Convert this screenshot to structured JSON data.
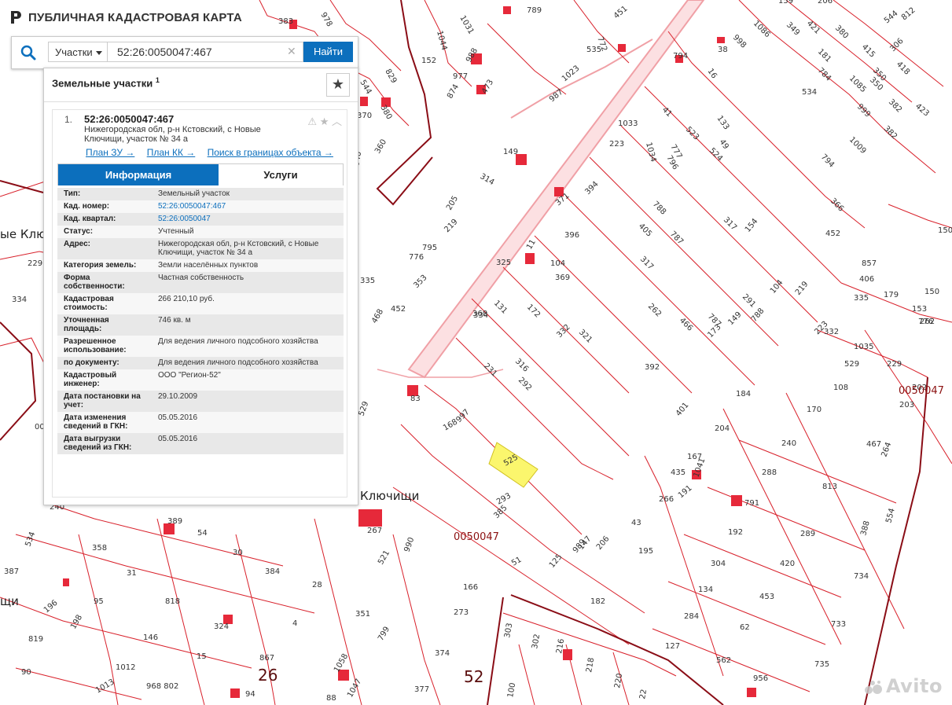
{
  "app": {
    "title": "ПУБЛИЧНАЯ КАДАСТРОВАЯ КАРТА"
  },
  "search": {
    "type": "Участки",
    "query": "52:26:0050047:467",
    "button": "Найти"
  },
  "panel": {
    "title": "Земельные участки",
    "count": "1",
    "result": {
      "number": "1.",
      "cadnum": "52:26:0050047:467",
      "address": "Нижегородская обл, р-н Кстовский, с Новые Ключищи, участок № 34 а",
      "links": [
        "План ЗУ →",
        "План КК →",
        "Поиск в границах объекта →"
      ],
      "tabs": [
        "Информация",
        "Услуги"
      ],
      "fields": [
        {
          "key": "Тип:",
          "value": "Земельный участок"
        },
        {
          "key": "Кад. номер:",
          "value": "52:26:0050047:467",
          "link": true
        },
        {
          "key": "Кад. квартал:",
          "value": "52:26:0050047",
          "link": true
        },
        {
          "key": "Статус:",
          "value": "Учтенный"
        },
        {
          "key": "Адрес:",
          "value": "Нижегородская обл, р-н Кстовский, с Новые Ключищи, участок № 34 а"
        },
        {
          "key": "Категория земель:",
          "value": "Земли населённых пунктов"
        },
        {
          "key": "Форма собственности:",
          "value": "Частная собственность"
        },
        {
          "key": "Кадастровая стоимость:",
          "value": "266 210,10 руб."
        },
        {
          "key": "Уточненная площадь:",
          "value": "746 кв. м"
        },
        {
          "key": "Разрешенное использование:",
          "value": "Для ведения личного подсобного хозяйства"
        },
        {
          "key": "по документу:",
          "value": "Для ведения личного подсобного хозяйства"
        },
        {
          "key": "Кадастровый инженер:",
          "value": "ООО \"Регион-52\""
        },
        {
          "key": "Дата постановки на учет:",
          "value": "29.10.2009"
        },
        {
          "key": "Дата изменения сведений в ГКН:",
          "value": "05.05.2016"
        },
        {
          "key": "Дата выгрузки сведений из ГКН:",
          "value": "05.05.2016"
        }
      ]
    }
  },
  "map": {
    "colors": {
      "parcel_line": "#d8202a",
      "highlight_fill": "#fbf66d",
      "building_fill": "#e6293a",
      "road": "#f6b0b4",
      "border": "#8a0d16"
    },
    "place_labels": [
      "Ключищи",
      "ые Ключ",
      "щи"
    ],
    "quarter_labels": [
      "0050047",
      "0050047"
    ],
    "district_labels": [
      "26",
      "52"
    ],
    "parcel_numbers": [
      "383",
      "978",
      "1031",
      "789",
      "451",
      "159",
      "206",
      "812",
      "1044",
      "988",
      "772",
      "998",
      "1086",
      "349",
      "421",
      "380",
      "544",
      "152",
      "535",
      "38",
      "181",
      "415",
      "306",
      "544",
      "829",
      "977",
      "1023",
      "794",
      "16",
      "784",
      "1085",
      "350",
      "418",
      "380",
      "874",
      "473",
      "987",
      "534",
      "999",
      "382",
      "423",
      "370",
      "133",
      "41",
      "523",
      "49",
      "382",
      "350",
      "360",
      "1033",
      "223",
      "1034",
      "777",
      "524",
      "1009",
      "040",
      "149",
      "796",
      "314",
      "794",
      "366",
      "452",
      "205",
      "394",
      "788",
      "219",
      "371",
      "405",
      "787",
      "154",
      "776",
      "396",
      "317",
      "150",
      "795",
      "325",
      "11",
      "104",
      "857",
      "406",
      "335",
      "353",
      "369",
      "317",
      "406",
      "229",
      "334",
      "131",
      "172",
      "291",
      "104",
      "219",
      "179",
      "452",
      "368",
      "262",
      "150",
      "335",
      "468",
      "321",
      "787",
      "223",
      "776",
      "332",
      "466",
      "149",
      "788",
      "153",
      "334",
      "262",
      "332",
      "1035",
      "529",
      "231",
      "316",
      "292",
      "392",
      "173",
      "229",
      "529",
      "83",
      "997",
      "108",
      "184",
      "202",
      "0050047",
      "168",
      "401",
      "170",
      "204",
      "203",
      "525",
      "467",
      "240",
      "265",
      "167",
      "435",
      "1041",
      "791",
      "288",
      "264",
      "240",
      "266",
      "191",
      "813",
      "389",
      "54",
      "385",
      "293",
      "267",
      "43",
      "192",
      "289",
      "388",
      "554",
      "534",
      "358",
      "30",
      "384",
      "521",
      "990",
      "989",
      "206",
      "195",
      "304",
      "420",
      "387",
      "31",
      "28",
      "147",
      "125",
      "734",
      "818",
      "95",
      "166",
      "51",
      "182",
      "134",
      "453",
      "196",
      "198",
      "324",
      "4",
      "351",
      "273",
      "284",
      "733",
      "146",
      "819",
      "15",
      "799",
      "374",
      "303",
      "302",
      "216",
      "127",
      "62",
      "1012",
      "867",
      "1058",
      "218",
      "562",
      "735",
      "90",
      "1013",
      "968 802",
      "94",
      "377",
      "1047",
      "88",
      "100",
      "220",
      "22",
      "956"
    ],
    "watermark": "Avito"
  }
}
